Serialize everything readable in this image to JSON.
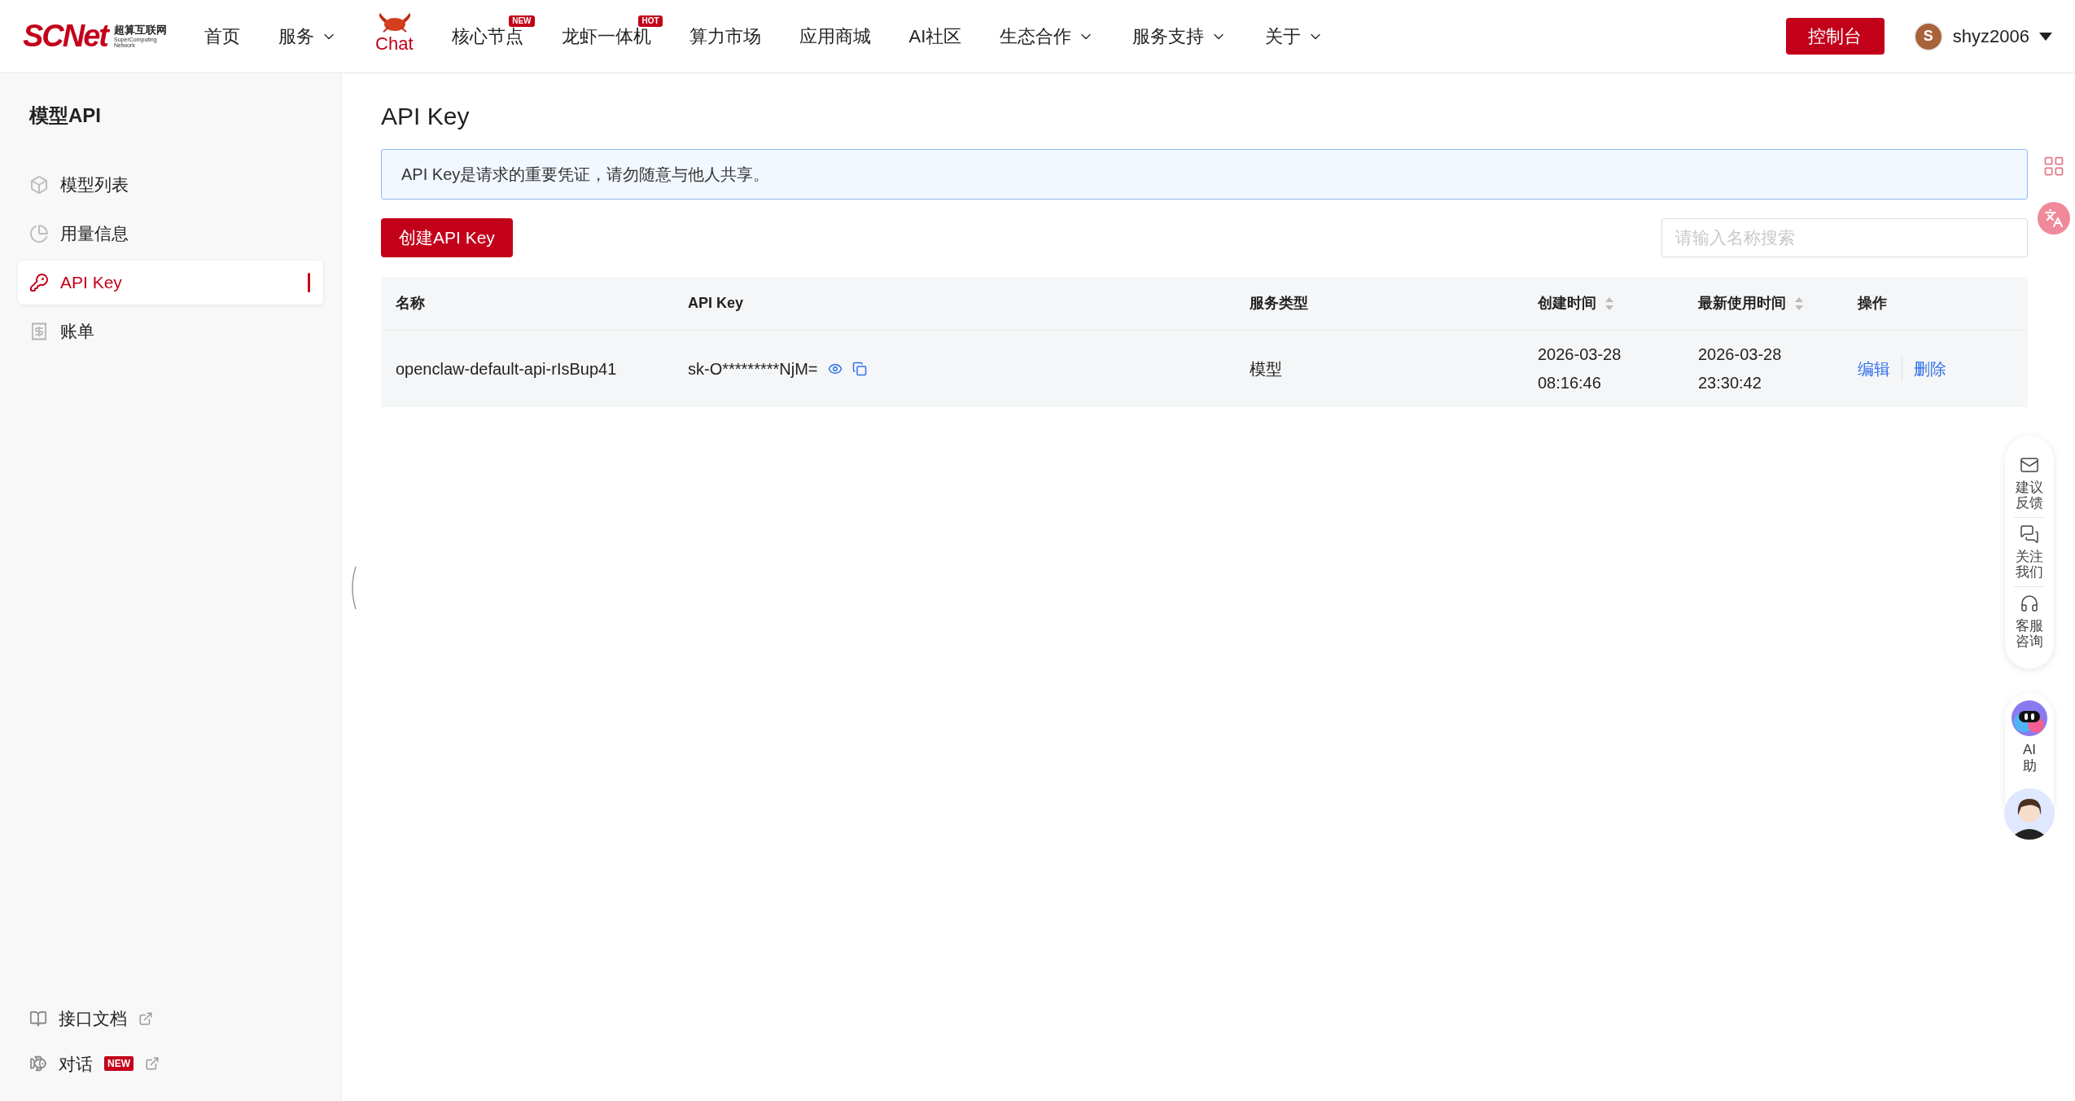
{
  "logo": {
    "brand": "SCNet",
    "cn": "超算互联网",
    "en_line1": "SuperComputing",
    "en_line2": "Network"
  },
  "nav": [
    {
      "label": "首页",
      "kind": "link"
    },
    {
      "label": "服务",
      "kind": "dropdown"
    },
    {
      "label": "Chat",
      "kind": "featured"
    },
    {
      "label": "核心节点",
      "kind": "link",
      "badge": "NEW"
    },
    {
      "label": "龙虾一体机",
      "kind": "link",
      "badge": "HOT"
    },
    {
      "label": "算力市场",
      "kind": "link"
    },
    {
      "label": "应用商城",
      "kind": "link"
    },
    {
      "label": "AI社区",
      "kind": "link"
    },
    {
      "label": "生态合作",
      "kind": "dropdown"
    },
    {
      "label": "服务支持",
      "kind": "dropdown"
    },
    {
      "label": "关于",
      "kind": "dropdown"
    }
  ],
  "console_button": "控制台",
  "user": {
    "initial": "S",
    "name": "shyz2006"
  },
  "sidebar": {
    "title": "模型API",
    "items": [
      {
        "label": "模型列表",
        "selected": false
      },
      {
        "label": "用量信息",
        "selected": false
      },
      {
        "label": "API Key",
        "selected": true
      },
      {
        "label": "账单",
        "selected": false
      }
    ],
    "links": [
      {
        "label": "接口文档"
      },
      {
        "label": "对话",
        "badge": "NEW"
      }
    ]
  },
  "page": {
    "title": "API Key",
    "notice": "API Key是请求的重要凭证，请勿随意与他人共享。",
    "create_button": "创建API Key",
    "search": {
      "placeholder": "请输入名称搜索"
    }
  },
  "table": {
    "columns": [
      {
        "label": "名称",
        "sortable": false
      },
      {
        "label": "API Key",
        "sortable": false
      },
      {
        "label": "服务类型",
        "sortable": false
      },
      {
        "label": "创建时间",
        "sortable": true
      },
      {
        "label": "最新使用时间",
        "sortable": true
      },
      {
        "label": "操作",
        "sortable": false
      }
    ],
    "rows": [
      {
        "name": "openclaw-default-api-rIsBup41",
        "key": "sk-O*********NjM=",
        "service": "模型",
        "created": [
          "2026-03-28",
          "08:16:46"
        ],
        "last_used": [
          "2026-03-28",
          "23:30:42"
        ],
        "actions": [
          "编辑",
          "删除"
        ]
      }
    ]
  },
  "float_panel": [
    {
      "label": "建议反馈"
    },
    {
      "label": "关注我们"
    },
    {
      "label": "客服咨询"
    }
  ],
  "assistant": {
    "label": "AI助"
  }
}
